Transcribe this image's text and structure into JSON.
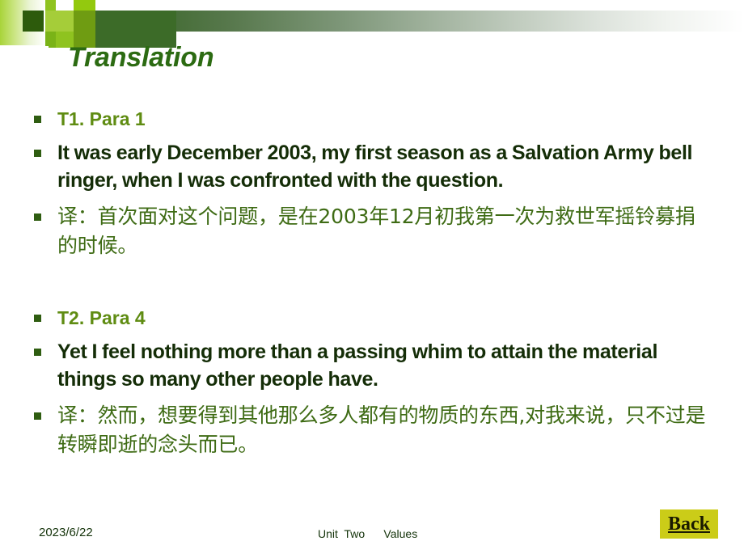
{
  "slide": {
    "title": "Translation",
    "sections": [
      {
        "heading": "T1. Para 1",
        "english": "It was early December 2003, my first season as a Salvation Army bell ringer, when I was confronted with the question.",
        "chinese": "译：首次面对这个问题，是在2003年12月初我第一次为救世军摇铃募捐的时候。"
      },
      {
        "heading": "T2. Para 4",
        "english": "Yet I feel nothing more than a passing whim to attain the material things so many other people have.",
        "chinese": "译：然而，想要得到其他那么多人都有的物质的东西,对我来说，只不过是转瞬即逝的念头而已。"
      }
    ]
  },
  "footer": {
    "date": "2023/6/22",
    "center": "Unit  Two      Values",
    "back_label": "Back"
  },
  "colors": {
    "title_green": "#2c6b12",
    "heading_green": "#5f8c12",
    "english_dark": "#142d07",
    "chinese_green": "#3e6b14",
    "bullet_green": "#2f5d11",
    "band_dark": "#35621f",
    "accent_lime": "#8fc31f",
    "back_bg": "#cbcc18"
  }
}
